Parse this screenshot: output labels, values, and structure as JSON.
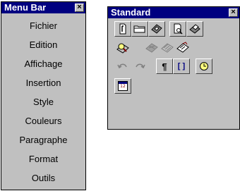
{
  "menu_bar": {
    "title": "Menu Bar",
    "close_glyph": "×",
    "items": [
      {
        "label": "Fichier"
      },
      {
        "label": "Edition"
      },
      {
        "label": "Affichage"
      },
      {
        "label": "Insertion"
      },
      {
        "label": "Style"
      },
      {
        "label": "Couleurs"
      },
      {
        "label": "Paragraphe"
      },
      {
        "label": "Format"
      },
      {
        "label": "Outils"
      }
    ]
  },
  "standard_toolbar": {
    "title": "Standard",
    "close_glyph": "×",
    "buttons": [
      {
        "icon": "new-document-icon",
        "enabled": true
      },
      {
        "icon": "open-folder-icon",
        "enabled": true
      },
      {
        "icon": "save-icon",
        "enabled": true
      },
      {
        "icon": "print-preview-icon",
        "enabled": true
      },
      {
        "icon": "print-icon",
        "enabled": true
      },
      {
        "icon": "find-icon",
        "enabled": true
      },
      {
        "icon": "cut-icon",
        "enabled": false
      },
      {
        "icon": "copy-icon",
        "enabled": false
      },
      {
        "icon": "paste-icon",
        "enabled": true
      },
      {
        "icon": "undo-icon",
        "enabled": false
      },
      {
        "icon": "redo-icon",
        "enabled": false
      },
      {
        "icon": "pilcrow-icon",
        "enabled": true,
        "glyph": "¶"
      },
      {
        "icon": "brackets-icon",
        "enabled": true,
        "glyph": "[ ]"
      },
      {
        "icon": "clock-icon",
        "enabled": true
      },
      {
        "icon": "calendar-icon",
        "enabled": true,
        "glyph": "12"
      }
    ]
  },
  "colors": {
    "titlebar": "#000080",
    "face": "#c0c0c0"
  }
}
